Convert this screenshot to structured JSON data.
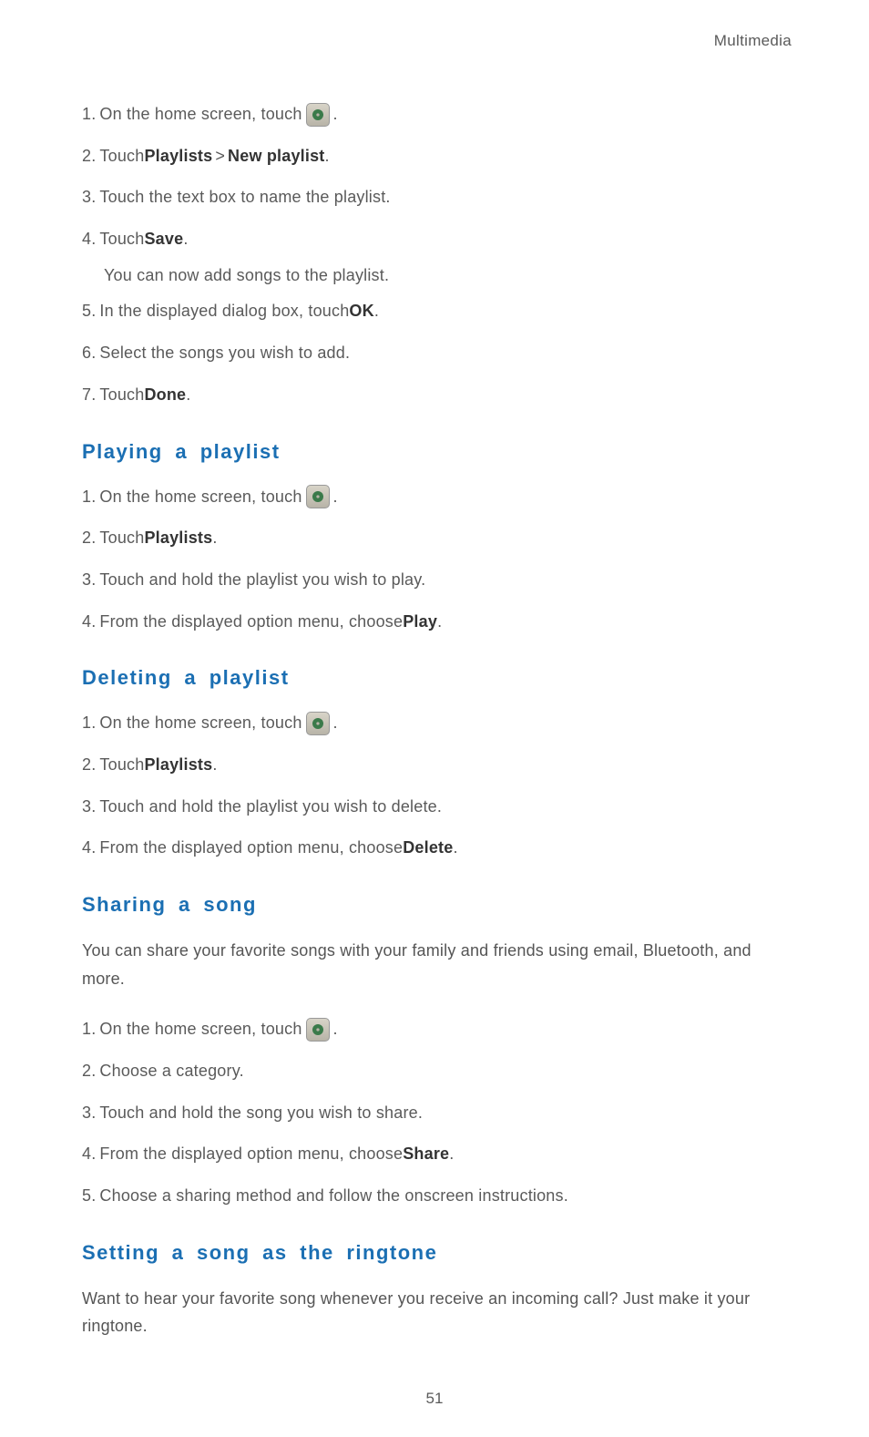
{
  "header": "Multimedia",
  "sections": {
    "s1": {
      "steps": {
        "1": {
          "num": "1.",
          "pre": "On the home screen, touch ",
          "post": " ."
        },
        "2": {
          "num": "2.",
          "pre": "Touch ",
          "b1": "Playlists",
          "gt": ">",
          "b2": "New playlist",
          "post": "."
        },
        "3": {
          "num": "3.",
          "text": "Touch the text box to name the playlist."
        },
        "4": {
          "num": "4.",
          "pre": "Touch ",
          "b1": "Save",
          "post": "."
        },
        "4note": "You can now add songs to the playlist.",
        "5": {
          "num": "5.",
          "pre": "In the displayed dialog box, touch ",
          "b1": "OK",
          "post": "."
        },
        "6": {
          "num": "6.",
          "text": "Select the songs you wish to add."
        },
        "7": {
          "num": "7.",
          "pre": "Touch ",
          "b1": "Done",
          "post": "."
        }
      }
    },
    "s2": {
      "heading": "Playing a playlist",
      "steps": {
        "1": {
          "num": "1.",
          "pre": "On the home screen, touch ",
          "post": " ."
        },
        "2": {
          "num": "2.",
          "pre": "Touch ",
          "b1": "Playlists",
          "post": "."
        },
        "3": {
          "num": "3.",
          "text": "Touch and hold the playlist you wish to play."
        },
        "4": {
          "num": "4.",
          "pre": "From the displayed option menu, choose ",
          "b1": "Play",
          "post": "."
        }
      }
    },
    "s3": {
      "heading": "Deleting a playlist",
      "steps": {
        "1": {
          "num": "1.",
          "pre": "On the home screen, touch ",
          "post": " ."
        },
        "2": {
          "num": "2.",
          "pre": "Touch ",
          "b1": "Playlists",
          "post": "."
        },
        "3": {
          "num": "3.",
          "text": "Touch and hold the playlist you wish to delete."
        },
        "4": {
          "num": "4.",
          "pre": "From the displayed option menu, choose ",
          "b1": "Delete",
          "post": "."
        }
      }
    },
    "s4": {
      "heading": "Sharing a song",
      "intro": "You can share your favorite songs with your family and friends using email, Bluetooth, and more.",
      "steps": {
        "1": {
          "num": "1.",
          "pre": "On the home screen, touch ",
          "post": " ."
        },
        "2": {
          "num": "2.",
          "text": "Choose a category."
        },
        "3": {
          "num": "3.",
          "text": "Touch and hold the song you wish to share."
        },
        "4": {
          "num": "4.",
          "pre": "From the displayed option menu, choose ",
          "b1": "Share",
          "post": "."
        },
        "5": {
          "num": "5.",
          "text": "Choose a sharing method and follow the onscreen instructions."
        }
      }
    },
    "s5": {
      "heading": "Setting a song as the ringtone",
      "intro": "Want to hear your favorite song whenever you receive an incoming call? Just make it your ringtone."
    }
  },
  "pageNumber": "51"
}
